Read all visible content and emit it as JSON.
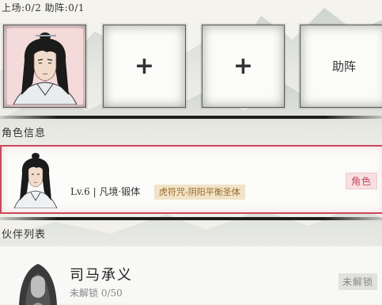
{
  "header": {
    "lineup_text": "上场:0/2 助阵:0/1"
  },
  "slots": [
    {
      "kind": "character",
      "icon": "character-portrait"
    },
    {
      "kind": "empty",
      "label": "+"
    },
    {
      "kind": "empty",
      "label": "+"
    },
    {
      "kind": "support",
      "label": "助阵"
    }
  ],
  "character_info": {
    "section_title": "角色信息",
    "level_realm": "Lv.6 | 凡境·锻体",
    "skill_tag": "虎符咒-阴阳平衡圣体",
    "role_badge": "角色"
  },
  "partner_list": {
    "section_title": "伙伴列表",
    "partners": [
      {
        "name": "司马承义",
        "status": "未解锁 0/50",
        "badge": "未解锁"
      }
    ]
  },
  "colors": {
    "accent_red": "#c9485a",
    "tag_gold": "#9a6a2a",
    "locked_gray": "#888888"
  }
}
